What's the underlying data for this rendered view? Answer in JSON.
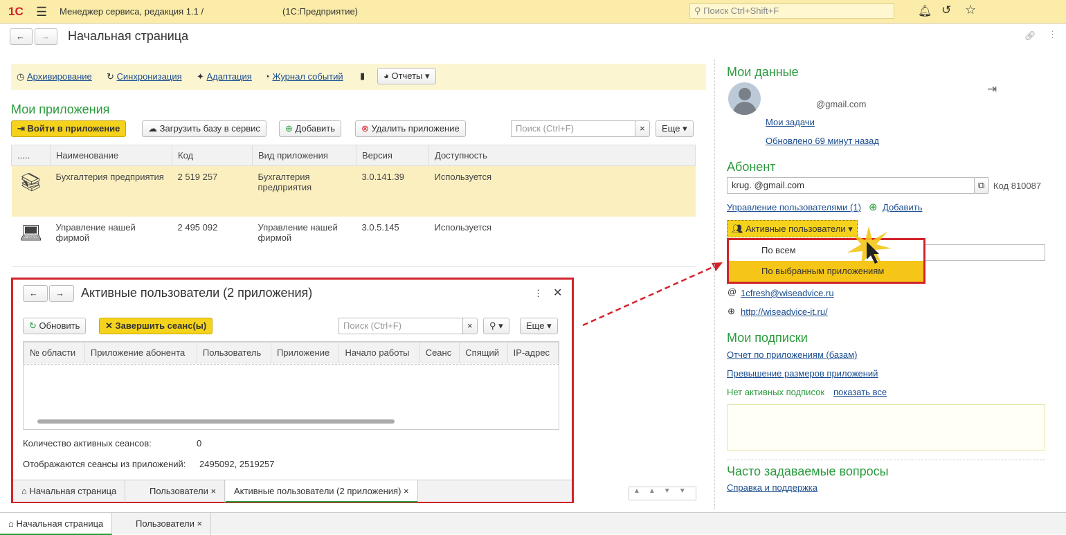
{
  "topbar": {
    "app_title": "Менеджер сервиса, редакция 1.1 /",
    "platform": "(1С:Предприятие)",
    "search_placeholder": "Поиск Ctrl+Shift+F",
    "logo": "1С"
  },
  "page": {
    "title": "Начальная страница"
  },
  "toolbar": {
    "archive": "Архивирование",
    "sync": "Синхронизация",
    "adapt": "Адаптация",
    "log": "Журнал событий",
    "reports": "Отчеты"
  },
  "apps": {
    "title": "Мои приложения",
    "enter": "Войти в приложение",
    "upload": "Загрузить базу в сервис",
    "add": "Добавить",
    "delete": "Удалить приложение",
    "search_placeholder": "Поиск (Ctrl+F)",
    "more": "Еще",
    "columns": [
      ".....",
      "Наименование",
      "Код",
      "Вид приложения",
      "Версия",
      "Доступность"
    ],
    "rows": [
      {
        "name": "Бухгалтерия предприятия",
        "code": "2 519 257",
        "kind": "Бухгалтерия предприятия",
        "version": "3.0.141.39",
        "status": "Используется"
      },
      {
        "name": "Управление нашей фирмой",
        "code": "2 495 092",
        "kind": "Управление нашей фирмой",
        "version": "3.0.5.145",
        "status": "Используется"
      }
    ]
  },
  "popup": {
    "title": "Активные пользователи (2 приложения)",
    "refresh": "Обновить",
    "end": "Завершить сеанс(ы)",
    "search_placeholder": "Поиск (Ctrl+F)",
    "more": "Еще",
    "columns": [
      "№ области",
      "Приложение абонента",
      "Пользователь",
      "Приложение",
      "Начало работы",
      "Сеанс",
      "Спящий",
      "IP-адрес"
    ],
    "count_label": "Количество активных сеансов:",
    "count_value": "0",
    "shown_label": "Отображаются сеансы из приложений:",
    "shown_value": "2495092, 2519257",
    "tabs": [
      "Начальная страница",
      "Пользователи",
      "Активные пользователи (2 приложения)"
    ]
  },
  "right": {
    "my_data": "Мои данные",
    "email": "@gmail.com",
    "tasks": "Мои задачи",
    "updated": "Обновлено 69 минут назад",
    "subscriber": "Абонент",
    "sub_value": "krug.          @gmail.com",
    "code": "Код 810087",
    "manage_users": "Управление пользователями (1)",
    "add": "Добавить",
    "active_users": "Активные пользователи",
    "menu": [
      "По всем",
      "По выбранным приложениям"
    ],
    "contact_email": "1cfresh@wiseadvice.ru",
    "site": "http://wiseadvice-it.ru/",
    "subs_title": "Мои подписки",
    "sub1": "Отчет по приложениям (базам)",
    "sub2": "Превышение размеров приложений",
    "no_subs": "Нет активных подписок",
    "show_all": "показать все",
    "faq": "Часто задаваемые вопросы",
    "help": "Справка и поддержка"
  },
  "bottom_tabs": [
    "Начальная страница",
    "Пользователи"
  ]
}
